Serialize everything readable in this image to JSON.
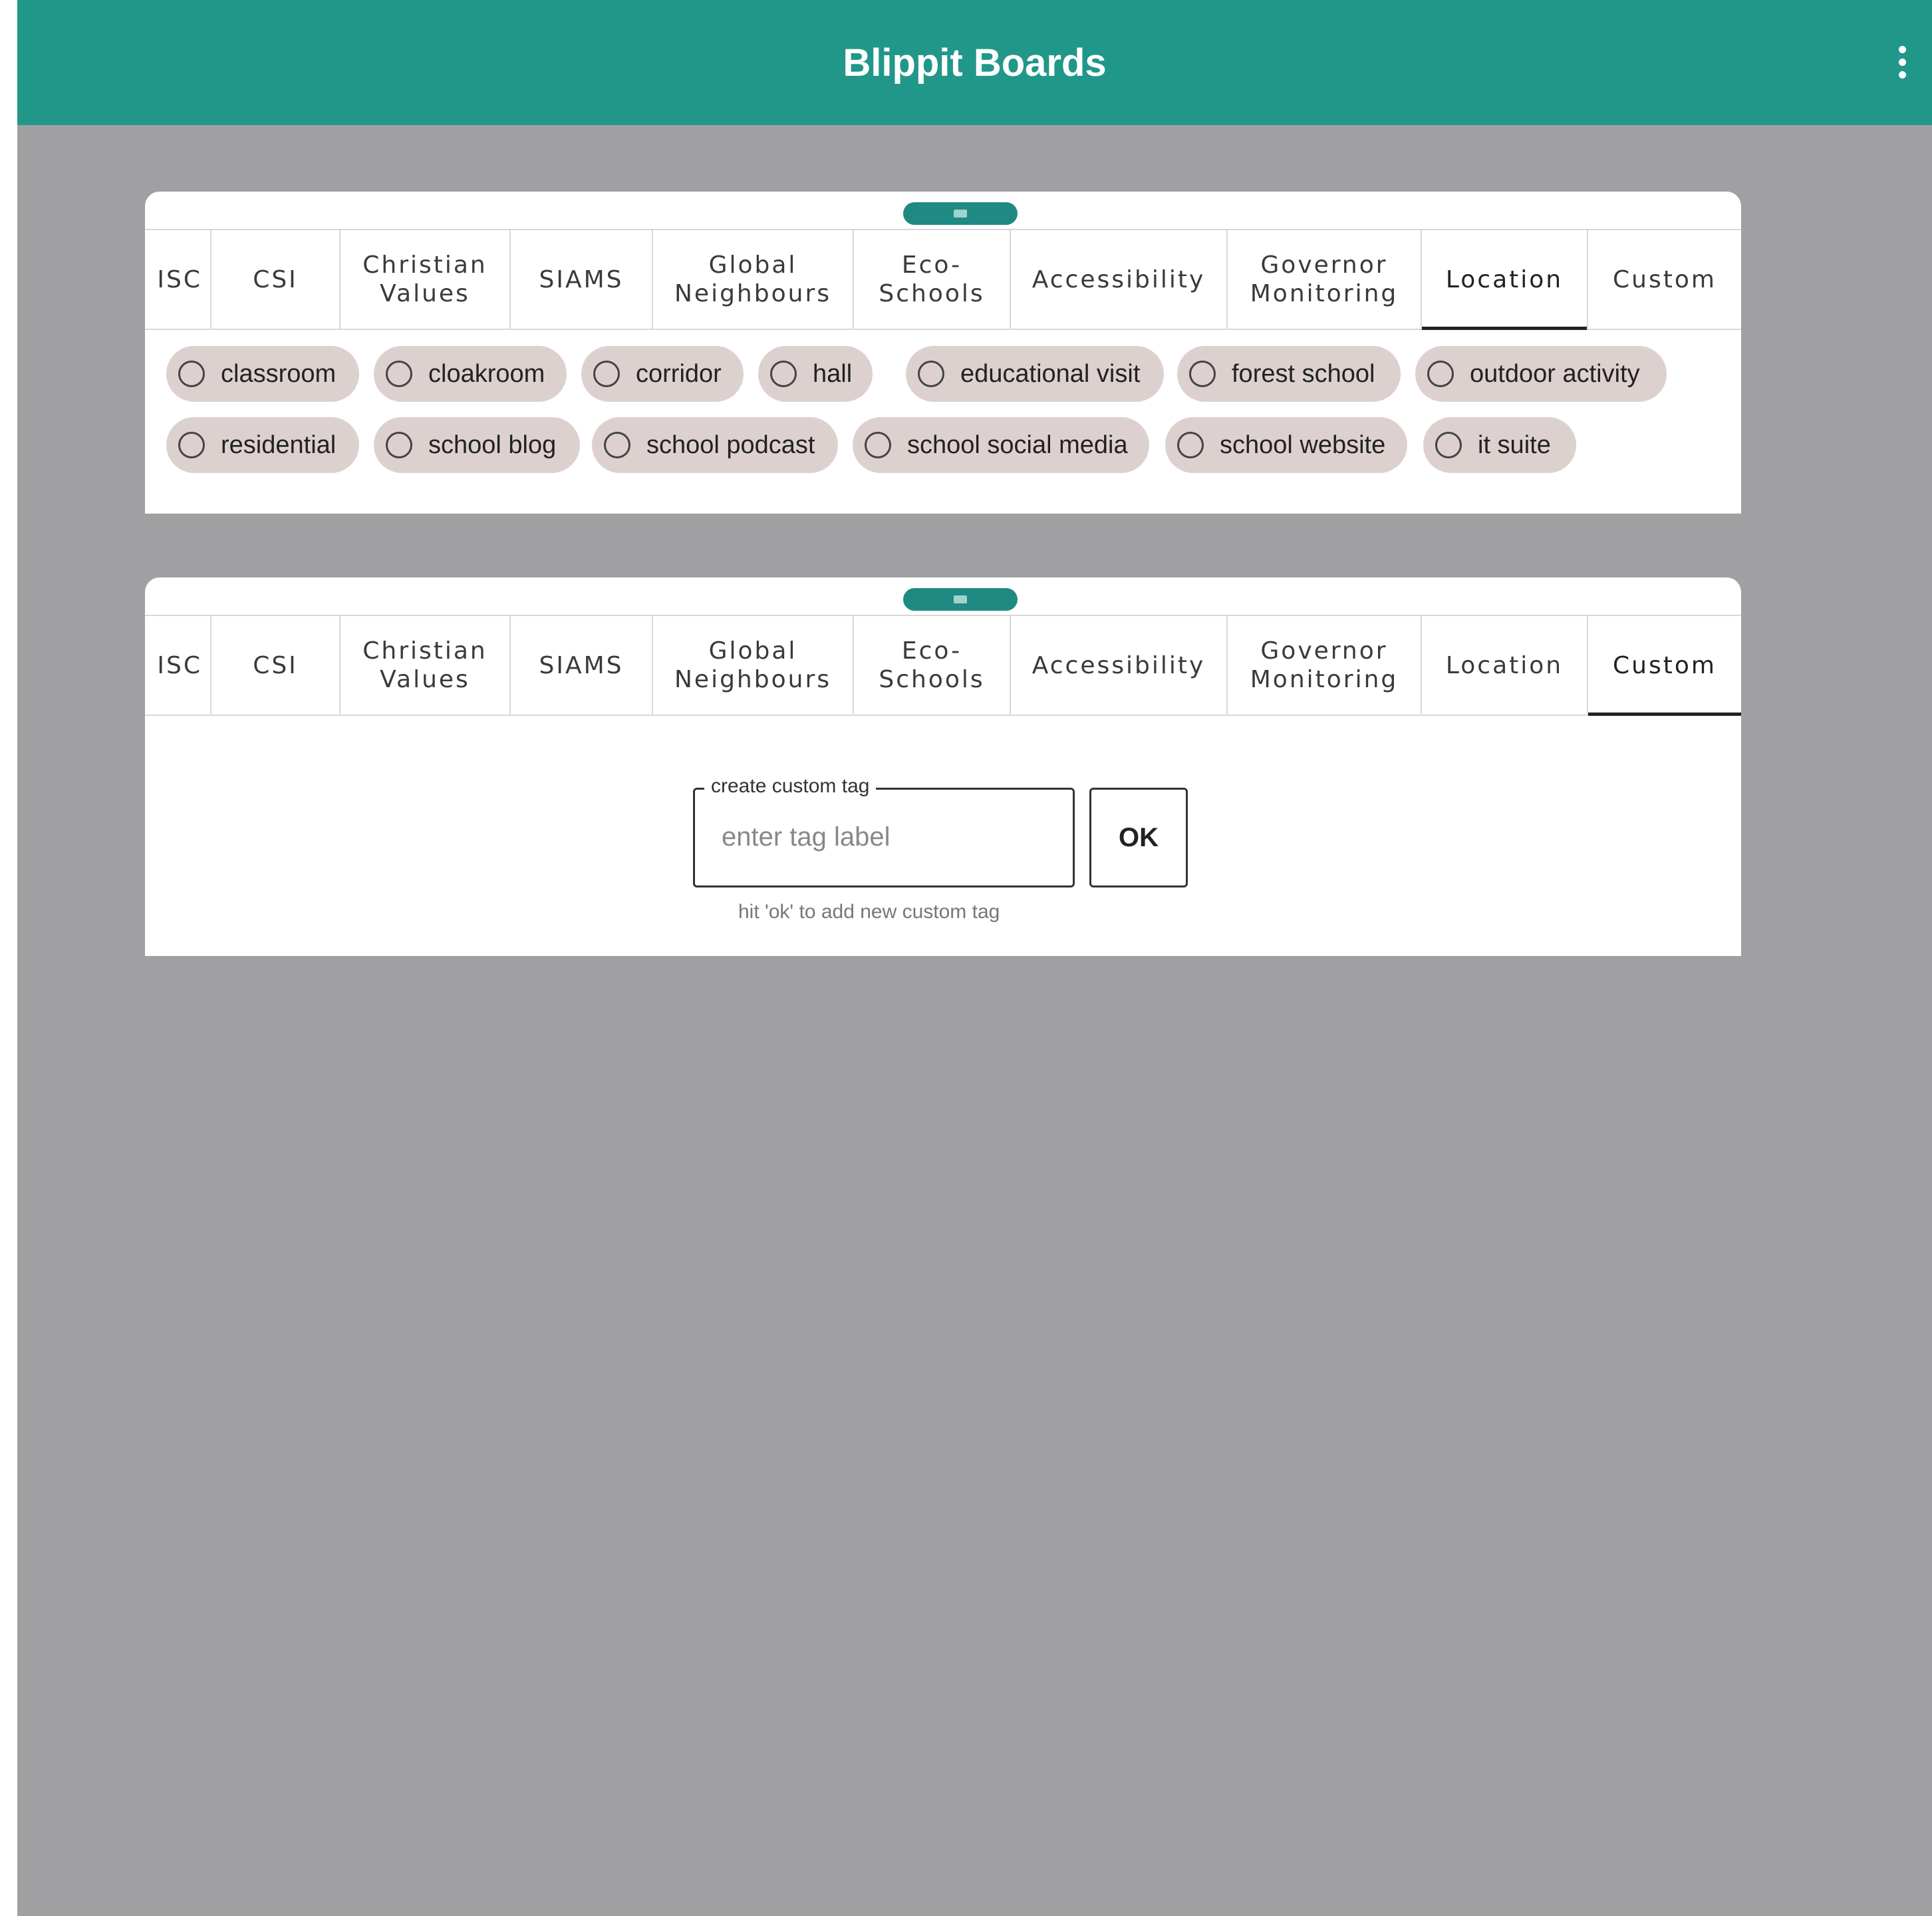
{
  "app": {
    "title": "Blippit Boards",
    "accent_color": "#219789",
    "background_color": "#a0a0a2",
    "menu_icon": "more-vertical-icon"
  },
  "tabs": [
    "ISC",
    "CSI",
    "Christian\nValues",
    "SIAMS",
    "Global\nNeighbours",
    "Eco-\nSchools",
    "Accessibility",
    "Governor\nMonitoring",
    "Location",
    "Custom"
  ],
  "panel1": {
    "active_tab": "Location",
    "chips": [
      "classroom",
      "cloakroom",
      "corridor",
      "hall",
      "educational visit",
      "forest school",
      "outdoor activity",
      "residential",
      "school blog",
      "school podcast",
      "school social media",
      "school website",
      "it suite"
    ]
  },
  "panel2": {
    "active_tab": "Custom",
    "custom_field": {
      "legend": "create custom tag",
      "placeholder": "enter tag label",
      "value": "",
      "button_label": "OK",
      "helper": "hit 'ok' to add new custom tag"
    }
  }
}
